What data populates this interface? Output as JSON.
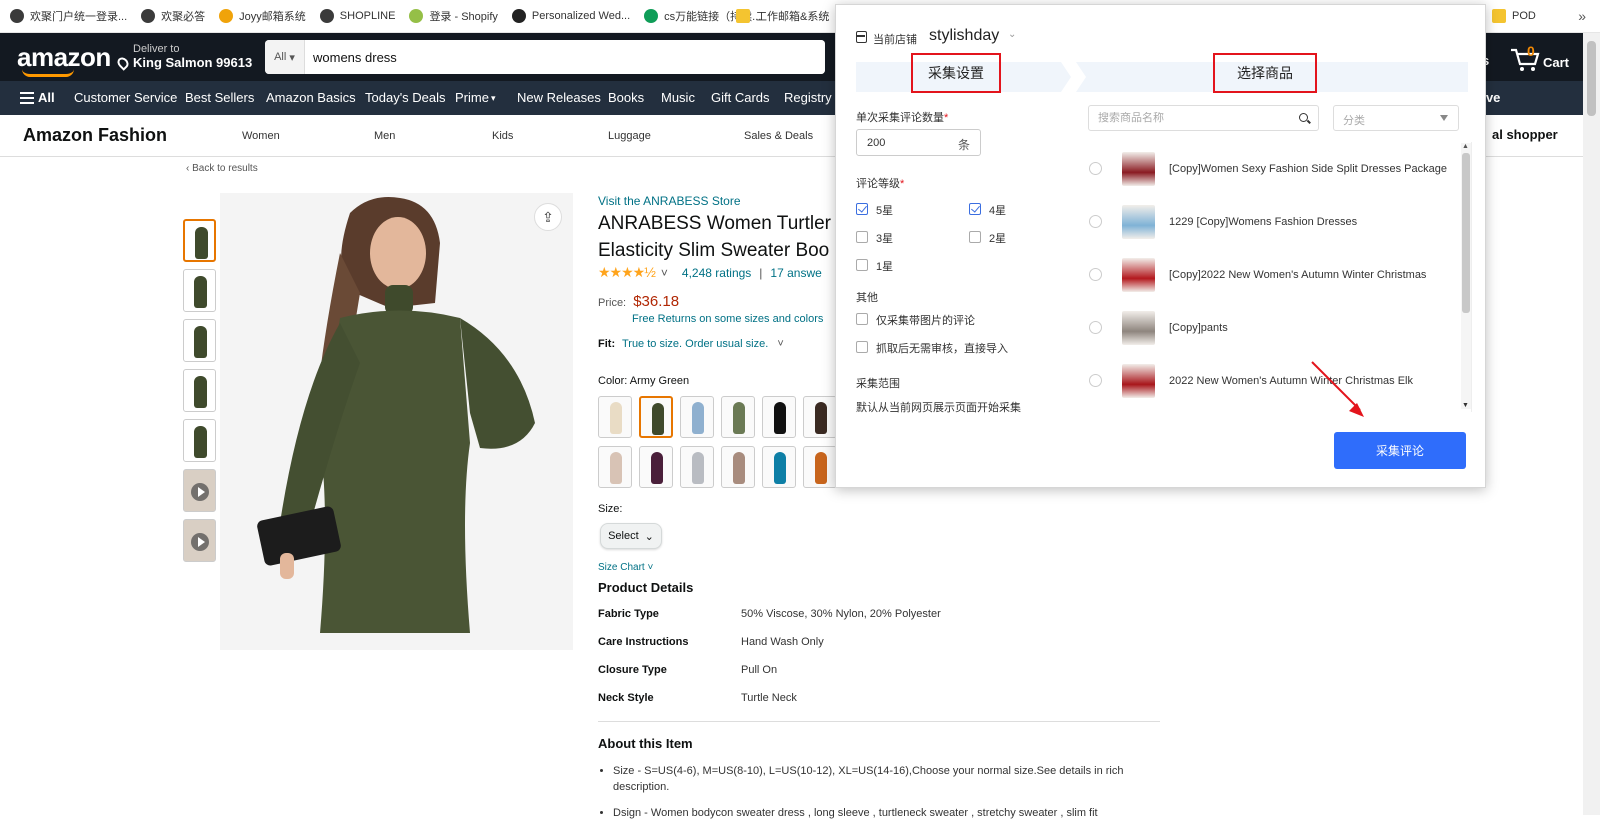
{
  "bookmarks": {
    "items": [
      {
        "label": "欢聚门户统一登录...",
        "color": "#3b3b3b"
      },
      {
        "label": "欢聚必答",
        "color": "#3b3b3b"
      },
      {
        "label": "Joyy邮箱系统",
        "color": "#f0a30a"
      },
      {
        "label": "SHOPLINE",
        "color": "#3b3b3b"
      },
      {
        "label": "登录 - Shopify",
        "color": "#95bf47"
      },
      {
        "label": "Personalized Wed...",
        "color": "#222222"
      },
      {
        "label": "cs万能链接（持续...",
        "color": "#0f9d58"
      },
      {
        "label": "工作邮箱&系统",
        "color": "#f4c430"
      },
      {
        "label": "POD",
        "color": "#f4c430"
      }
    ],
    "more": "»"
  },
  "nav": {
    "logo": "amazon",
    "deliver_line1": "Deliver to",
    "deliver_line2": "King Salmon 99613",
    "search_category": "All",
    "search_value": "womens dress",
    "right_fragment": "s",
    "cart_count": "0",
    "cart_label": "Cart"
  },
  "subnav": {
    "all": "All",
    "items": [
      "Customer Service",
      "Best Sellers",
      "Amazon Basics",
      "Today's Deals",
      "Prime",
      "New Releases",
      "Books",
      "Music",
      "Gift Cards",
      "Registry"
    ],
    "right_fragment": "tive"
  },
  "fashion": {
    "title": "Amazon Fashion",
    "items": [
      "Women",
      "Men",
      "Kids",
      "Luggage",
      "Sales & Deals"
    ],
    "right_fragment": "al shopper"
  },
  "product": {
    "back": "‹ Back to results",
    "store_link": "Visit the ANRABESS Store",
    "title_line1": "ANRABESS Women Turtler",
    "title_line2": "Elasticity Slim Sweater Boo",
    "stars": "★★★★½",
    "rating_value": 4.5,
    "ratings": "4,248 ratings",
    "answers": "17 answe",
    "price_label": "Price:",
    "price": "$36.18",
    "free_returns": "Free Returns on some sizes and colors",
    "fit_label": "Fit:",
    "fit_value": "True to size. Order usual size.",
    "color_label": "Color:",
    "color_value": "Army Green",
    "swatches": [
      "#e9dcc5",
      "#3f4a2c",
      "#8fb0cf",
      "#6b7a55",
      "#111111",
      "#3a2a22",
      "#d8c3b5",
      "#4a1f3a",
      "#b9bcc2",
      "#a88c7e",
      "#0e7fa6",
      "#c8651d"
    ],
    "size_label": "Size:",
    "size_select": "Select",
    "size_chart": "Size Chart",
    "details_heading": "Product Details",
    "details": [
      {
        "key": "Fabric Type",
        "value": "50% Viscose, 30% Nylon, 20% Polyester"
      },
      {
        "key": "Care Instructions",
        "value": "Hand Wash Only"
      },
      {
        "key": "Closure Type",
        "value": "Pull On"
      },
      {
        "key": "Neck Style",
        "value": "Turtle Neck"
      }
    ],
    "about_heading": "About this Item",
    "about": [
      "Size - S=US(4-6), M=US(8-10), L=US(10-12), XL=US(14-16),Choose your normal size.See details in rich description.",
      "Dsign - Women bodycon sweater dress , long sleeve , turtleneck sweater , stretchy sweater , slim fit"
    ]
  },
  "popup": {
    "store_label": "当前店铺",
    "store_name": "stylishday",
    "step1": "采集设置",
    "step2": "选择商品",
    "count_label": "单次采集评论数量",
    "count_value": "200",
    "count_unit": "条",
    "rating_label": "评论等级",
    "ratings": [
      {
        "label": "5星",
        "checked": true
      },
      {
        "label": "4星",
        "checked": true
      },
      {
        "label": "3星",
        "checked": false
      },
      {
        "label": "2星",
        "checked": false
      },
      {
        "label": "1星",
        "checked": false
      }
    ],
    "other_label": "其他",
    "other_options": [
      {
        "label": "仅采集带图片的评论",
        "checked": false
      },
      {
        "label": "抓取后无需审核，直接导入",
        "checked": false
      }
    ],
    "range_label": "采集范围",
    "range_desc": "默认从当前网页展示页面开始采集",
    "search_placeholder": "搜索商品名称",
    "category_placeholder": "分类",
    "products": [
      {
        "title": "[Copy]Women Sexy Fashion Side Split Dresses Package",
        "color": "#8a1b22"
      },
      {
        "title": "1229 [Copy]Womens Fashion Dresses",
        "color": "#7fb2d6"
      },
      {
        "title": "[Copy]2022 New Women's Autumn Winter Christmas",
        "color": "#b3191e"
      },
      {
        "title": "[Copy]pants",
        "color": "#8e857e"
      },
      {
        "title": "2022 New Women's Autumn Winter Christmas Elk",
        "color": "#a8161b"
      }
    ],
    "collect_button": "采集评论"
  }
}
